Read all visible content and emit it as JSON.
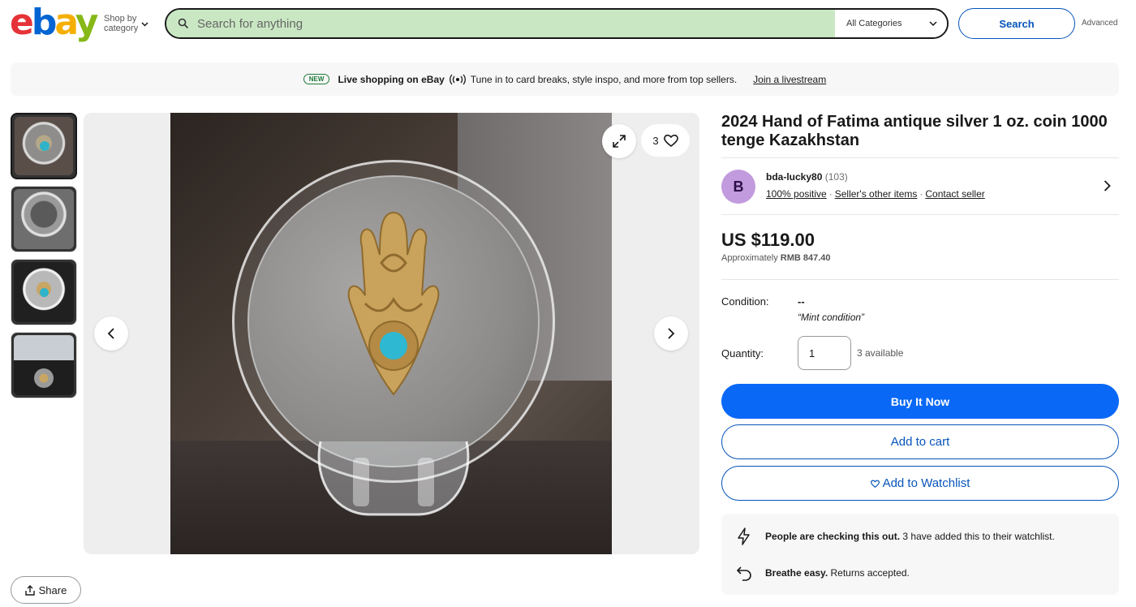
{
  "header": {
    "logo": [
      "e",
      "b",
      "a",
      "y"
    ],
    "shop_by_line1": "Shop by",
    "shop_by_line2": "category",
    "search_placeholder": "Search for anything",
    "category_select": "All Categories",
    "search_button": "Search",
    "advanced_link": "Advanced"
  },
  "banner": {
    "badge": "NEW",
    "title": "Live shopping on eBay",
    "text": "Tune in to card breaks, style inspo, and more from top sellers.",
    "link": "Join a livestream"
  },
  "gallery": {
    "watch_count": "3",
    "thumbnails": [
      "thumb-1",
      "thumb-2",
      "thumb-3",
      "thumb-4"
    ],
    "share_label": "Share"
  },
  "listing": {
    "title": "2024 Hand of Fatima antique silver 1 oz. coin 1000 tenge Kazakhstan",
    "seller": {
      "avatar_letter": "B",
      "name": "bda-lucky80",
      "feedback": "(103)",
      "positive": "100% positive",
      "other_items": "Seller's other items",
      "contact": "Contact seller"
    },
    "price": "US $119.00",
    "approx_label": "Approximately",
    "approx_value": "RMB 847.40",
    "condition_label": "Condition:",
    "condition_value": "--",
    "condition_desc": "“Mint condition”",
    "quantity_label": "Quantity:",
    "quantity_value": "1",
    "available": "3 available",
    "buy_now": "Buy It Now",
    "add_to_cart": "Add to cart",
    "add_to_watchlist": "Add to Watchlist"
  },
  "info_box": {
    "row1_bold": "People are checking this out.",
    "row1_text": "3 have added this to their watchlist.",
    "row2_bold": "Breathe easy.",
    "row2_text": "Returns accepted."
  }
}
